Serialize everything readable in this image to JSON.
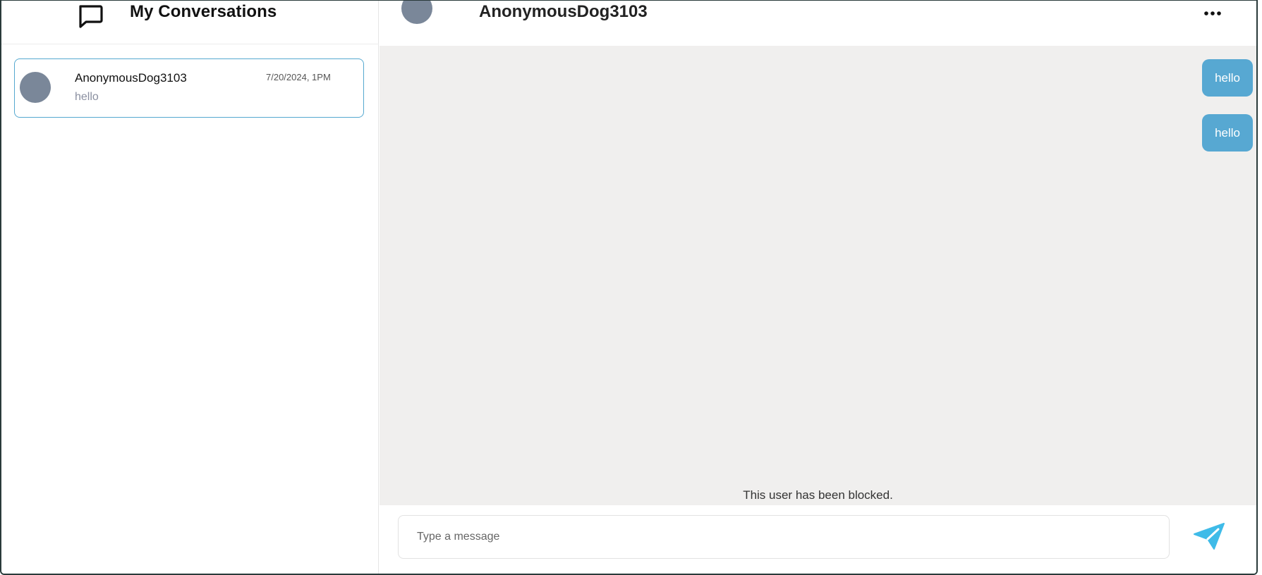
{
  "sidebar": {
    "title": "My Conversations",
    "icon": "chat-bubble-icon",
    "conversations": [
      {
        "name": "AnonymousDog3103",
        "time": "7/20/2024, 1PM",
        "preview": "hello"
      }
    ]
  },
  "chat": {
    "contact_name": "AnonymousDog3103",
    "more_icon": "ellipsis-icon",
    "messages": [
      {
        "text": "hello",
        "sender": "me"
      },
      {
        "text": "hello",
        "sender": "me"
      }
    ],
    "blocked_notice": "This user has been blocked.",
    "input": {
      "value": "",
      "placeholder": "Type a message"
    },
    "send_icon": "paper-plane-icon"
  },
  "colors": {
    "accent": "#57a8d2",
    "send_icon": "#3fbbe8",
    "avatar": "#7a8799",
    "chat_background": "#f0efee",
    "card_border": "#55a8d0"
  }
}
